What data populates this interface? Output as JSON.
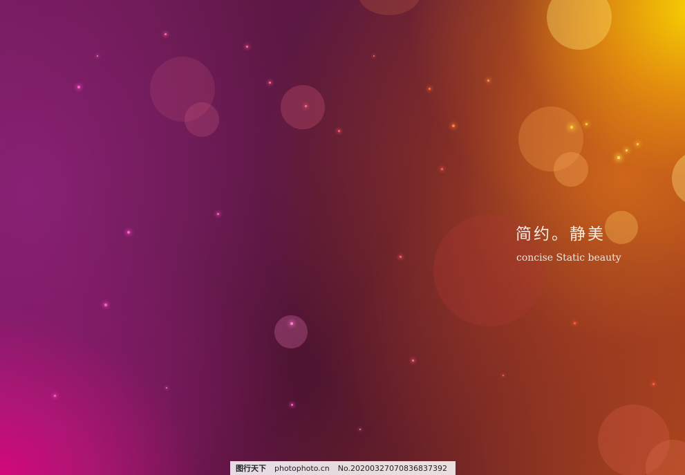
{
  "image": {
    "headline_cn": "简约。静美",
    "subtitle_en": "concise Static beauty"
  },
  "watermark": {
    "logo_text": "图行天下",
    "site": "photophoto.cn",
    "number": "No.20200327070836837392"
  },
  "colors": {
    "magenta": "#e8007f",
    "purple": "#7a1f6a",
    "maroon": "#4e1430",
    "orange": "#d9761c",
    "yellow": "#ffd800",
    "text": "#f6eee6"
  }
}
